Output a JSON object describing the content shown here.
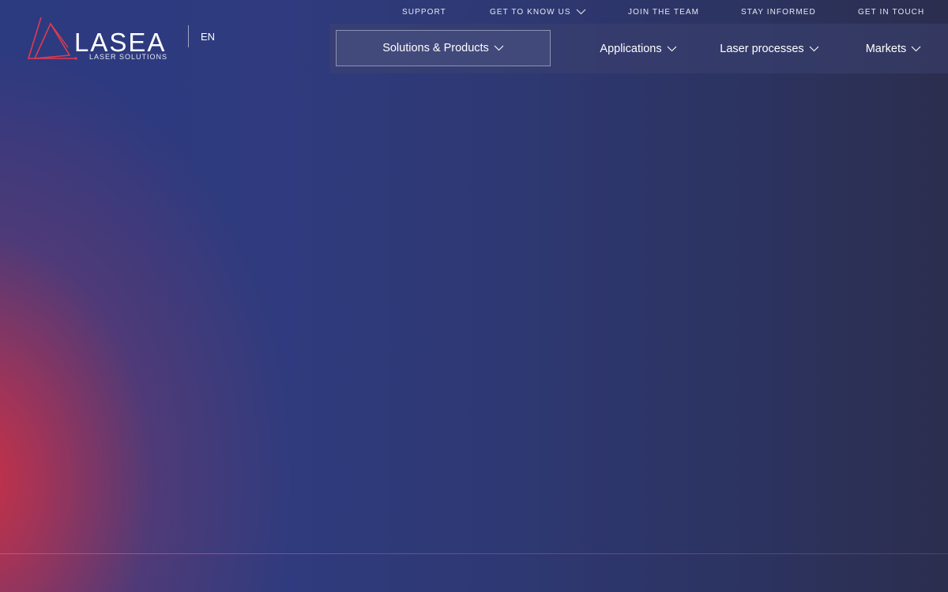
{
  "brand": {
    "name": "LASEA",
    "tagline": "LASER SOLUTIONS",
    "accent_color": "#e03a4e"
  },
  "language": {
    "current": "EN"
  },
  "top_nav": {
    "items": [
      {
        "label": "SUPPORT",
        "has_dropdown": false
      },
      {
        "label": "GET TO KNOW US",
        "has_dropdown": true
      },
      {
        "label": "JOIN THE TEAM",
        "has_dropdown": false
      },
      {
        "label": "STAY INFORMED",
        "has_dropdown": false
      },
      {
        "label": "GET IN TOUCH",
        "has_dropdown": false
      }
    ]
  },
  "main_nav": {
    "items": [
      {
        "label": "Solutions & Products",
        "has_dropdown": true,
        "active": true
      },
      {
        "label": "Applications",
        "has_dropdown": true,
        "active": false
      },
      {
        "label": "Laser processes",
        "has_dropdown": true,
        "active": false
      },
      {
        "label": "Markets",
        "has_dropdown": true,
        "active": false
      }
    ]
  },
  "icons": {
    "dropdown": "chevron-down-icon",
    "logo_mark": "triangle-logo-icon"
  },
  "colors": {
    "background_start": "#2c3a80",
    "background_end": "#2b2e4e",
    "glow": "#d6303e"
  }
}
